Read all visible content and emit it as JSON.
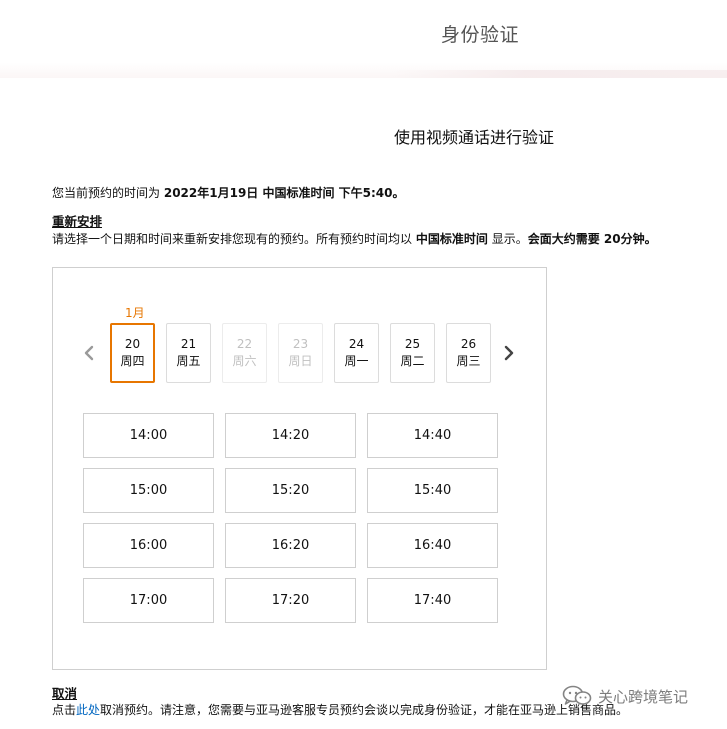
{
  "header": {
    "title": "身份验证"
  },
  "main": {
    "heading": "使用视频通话进行验证",
    "current": {
      "prefix": "您当前预约的时间为",
      "datetime": "2022年1月19日 中国标准时间 下午5:40",
      "suffix": "。"
    },
    "reschedule": {
      "title": "重新安排",
      "desc_a": "请选择一个日期和时间来重新安排您现有的预约。所有预约时间均以",
      "desc_b": "中国标准时间",
      "desc_c": "显示。",
      "desc_d": "会面大约需要 20分钟。"
    },
    "picker": {
      "month": "1月",
      "days": [
        {
          "num": "20",
          "weekday": "周四",
          "state": "selected"
        },
        {
          "num": "21",
          "weekday": "周五",
          "state": "available"
        },
        {
          "num": "22",
          "weekday": "周六",
          "state": "disabled"
        },
        {
          "num": "23",
          "weekday": "周日",
          "state": "disabled"
        },
        {
          "num": "24",
          "weekday": "周一",
          "state": "available"
        },
        {
          "num": "25",
          "weekday": "周二",
          "state": "available"
        },
        {
          "num": "26",
          "weekday": "周三",
          "state": "available"
        }
      ],
      "slots": [
        "14:00",
        "14:20",
        "14:40",
        "15:00",
        "15:20",
        "15:40",
        "16:00",
        "16:20",
        "16:40",
        "17:00",
        "17:20",
        "17:40"
      ]
    },
    "cancel": {
      "title": "取消",
      "desc_a": "点击",
      "link": "此处",
      "desc_b": "取消预约。请注意，您需要与亚马逊客服专员预约会谈以完成身份验证，才能在亚马逊上销售商品。"
    }
  },
  "watermark": {
    "text": "关心跨境笔记",
    "icon": "wechat-icon"
  },
  "colors": {
    "accent": "#e77600",
    "link": "#0066c0",
    "disabled": "#c0c0c0"
  }
}
